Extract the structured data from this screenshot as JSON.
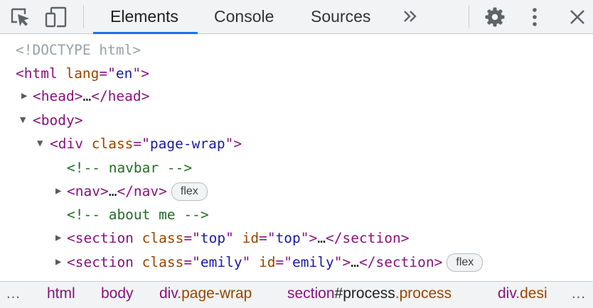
{
  "toolbar": {
    "tabs": [
      {
        "label": "Elements",
        "active": true
      },
      {
        "label": "Console",
        "active": false
      },
      {
        "label": "Sources",
        "active": false
      }
    ],
    "more_tabs": "»",
    "icons": [
      "inspect-element-icon",
      "device-toolbar-icon",
      "gear-icon",
      "kebab-menu-icon",
      "close-icon"
    ]
  },
  "tree": {
    "l0": {
      "text": "<!DOCTYPE html>"
    },
    "l1": {
      "open": "<html",
      "attr": "lang",
      "eq": "=\"",
      "val": "en",
      "close": "\">"
    },
    "l2": {
      "tag": "<head>",
      "ellip": "…",
      "end": "</head>"
    },
    "l3": {
      "tag": "<body>"
    },
    "l4": {
      "open": "<div",
      "attr": "class",
      "eq": "=\"",
      "val": "page-wrap",
      "close": "\">"
    },
    "l5": {
      "comment": "<!-- navbar -->"
    },
    "l6": {
      "tag": "<nav>",
      "ellip": "…",
      "end": "</nav>",
      "badge": "flex"
    },
    "l7": {
      "comment": "<!-- about me -->"
    },
    "l8": {
      "open": "<section",
      "attr1": "class",
      "val1": "top",
      "attr2": "id",
      "val2": "top",
      "close": "\">",
      "ellip": "…",
      "end": "</section>"
    },
    "l9": {
      "open": "<section",
      "attr1": "class",
      "val1": "emily",
      "attr2": "id",
      "val2": "emily",
      "close": "\">",
      "ellip": "…",
      "end": "</section>",
      "badge": "flex"
    }
  },
  "breadcrumb": {
    "leading_ellipsis": "…",
    "items": [
      {
        "tag": "html"
      },
      {
        "tag": "body"
      },
      {
        "tag": "div",
        "cls": ".page-wrap"
      },
      {
        "tag": "section",
        "id": "#process",
        "cls": ".process"
      },
      {
        "tag": "div",
        "cls": ".desi"
      }
    ],
    "trailing_ellipsis": "…"
  },
  "colors": {
    "tag": "#881280",
    "attribute": "#994500",
    "value": "#1a1aa6",
    "comment": "#236e25",
    "accent": "#1a73e8",
    "toolbar_bg": "#f1f3f4"
  }
}
